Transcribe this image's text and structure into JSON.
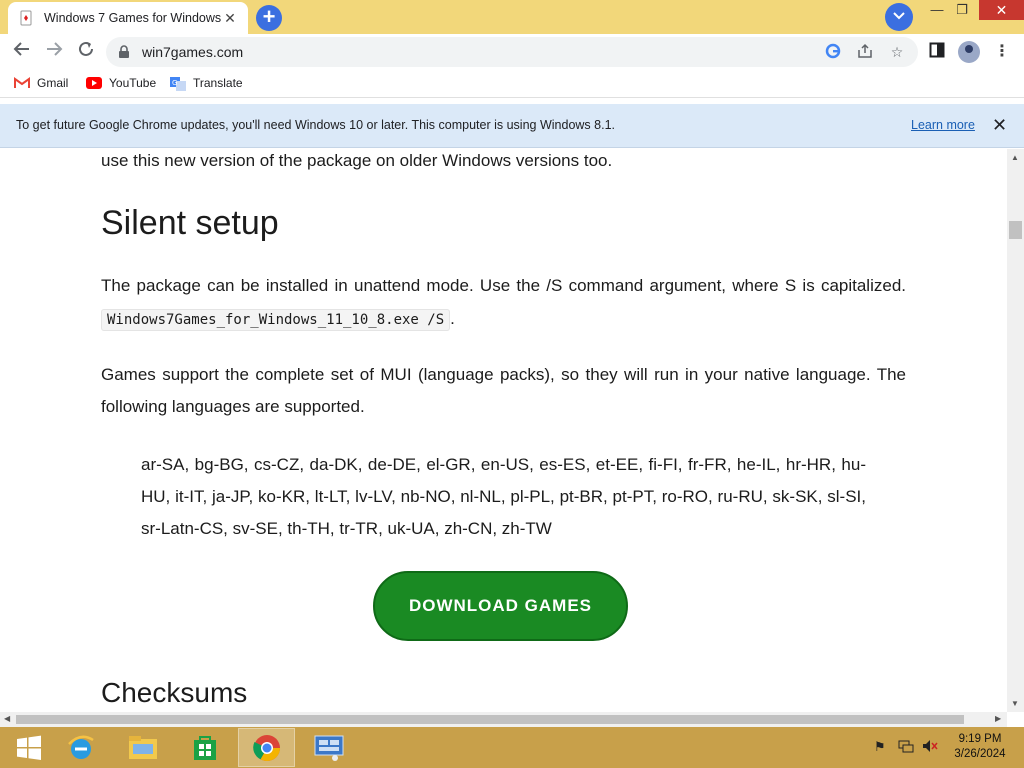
{
  "browser": {
    "tab_title": "Windows 7 Games for Windows",
    "url": "win7games.com",
    "bookmarks": [
      {
        "label": "Gmail",
        "icon": "gmail-icon"
      },
      {
        "label": "YouTube",
        "icon": "youtube-icon"
      },
      {
        "label": "Translate",
        "icon": "translate-icon"
      }
    ],
    "infobar": {
      "message": "To get future Google Chrome updates, you'll need Windows 10 or later. This computer is using Windows 8.1.",
      "link": "Learn more"
    }
  },
  "page": {
    "intro_tail": "use this new version of the package on older Windows versions too.",
    "silent_heading": "Silent setup",
    "silent_text": "The package can be installed in unattend mode. Use the /S command argument, where S is capitalized.",
    "silent_code": "Windows7Games_for_Windows_11_10_8.exe /S",
    "silent_after": ".",
    "mui_text": "Games support the complete set of MUI (language packs), so they will run in your native language. The following languages are supported.",
    "languages": "ar-SA, bg-BG, cs-CZ, da-DK, de-DE, el-GR, en-US, es-ES, et-EE, fi-FI, fr-FR, he-IL, hr-HR, hu-HU, it-IT, ja-JP, ko-KR, lt-LT, lv-LV, nb-NO, nl-NL, pl-PL, pt-BR, pt-PT, ro-RO, ru-RU, sk-SK, sl-SI, sr-Latn-CS, sv-SE, th-TH, tr-TR, uk-UA, zh-CN, zh-TW",
    "download_button": "DOWNLOAD GAMES",
    "checksums_heading": "Checksums"
  },
  "taskbar": {
    "time": "9:19 PM",
    "date": "3/26/2024"
  }
}
